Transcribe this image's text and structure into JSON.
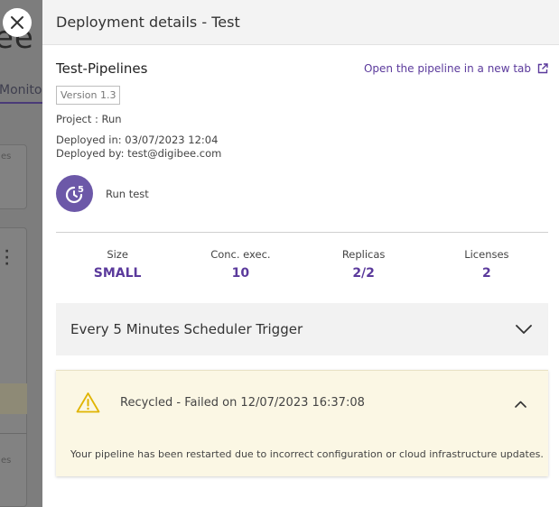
{
  "background": {
    "logo_text": "ee",
    "tab_text": "Monitor",
    "card1_text": "es",
    "card2_text": "es"
  },
  "panel": {
    "title": "Deployment details - Test"
  },
  "pipeline": {
    "name": "Test-Pipelines",
    "open_link": "Open the pipeline in a new tab",
    "version": "Version 1.3",
    "project": "Project : Run",
    "deployed_in": "Deployed in: 03/07/2023 12:04",
    "deployed_by": "Deployed by: test@digibee.com",
    "run_test_label": "Run test"
  },
  "stats": [
    {
      "label": "Size",
      "value": "SMALL"
    },
    {
      "label": "Conc. exec.",
      "value": "10"
    },
    {
      "label": "Replicas",
      "value": "2/2"
    },
    {
      "label": "Licenses",
      "value": "2"
    }
  ],
  "trigger": {
    "label": "Every 5 Minutes Scheduler Trigger"
  },
  "alert": {
    "title": "Recycled - Failed on 12/07/2023 16:37:08",
    "message": "Your pipeline has been restarted due to incorrect configuration or cloud infrastructure updates."
  },
  "colors": {
    "accent": "#5b3a9c",
    "avatar": "#6c58a8",
    "alert_bg": "#fbf7e4",
    "warning": "#e0b400"
  }
}
